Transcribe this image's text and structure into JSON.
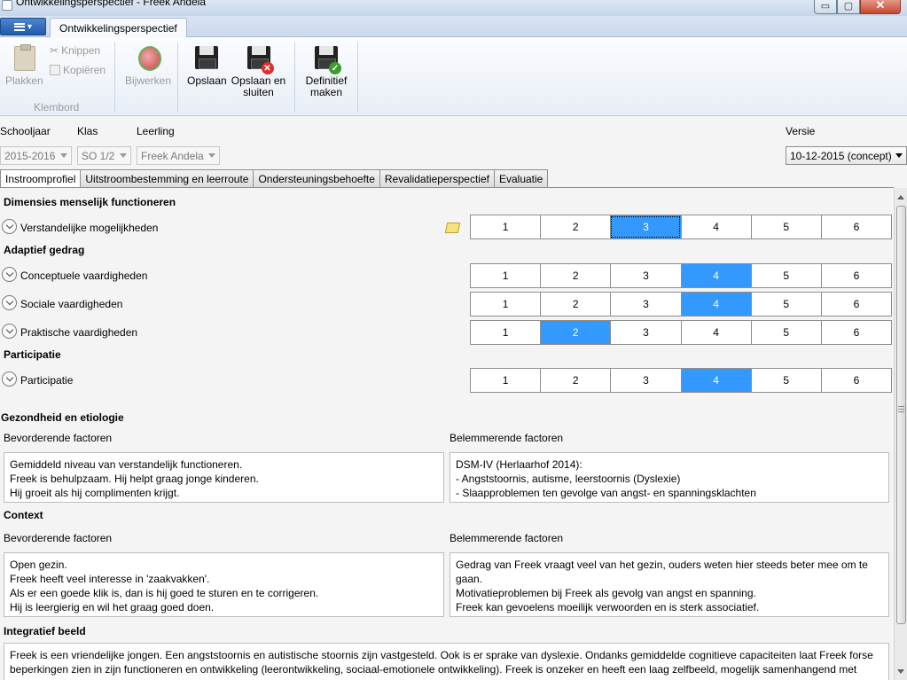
{
  "window": {
    "title": "Ontwikkelingsperspectief - Freek Andela",
    "minimize": "▭",
    "maximize": "▢",
    "close": "✕"
  },
  "ribbon": {
    "tab": "Ontwikkelingsperspectief",
    "paste": "Plakken",
    "cut": "Knippen",
    "copy": "Kopiëren",
    "clipboard_group": "Klembord",
    "update": "Bijwerken",
    "save": "Opslaan",
    "save_close": "Opslaan en sluiten",
    "finalize": "Definitief maken"
  },
  "selectors": {
    "schooljaar_label": "Schooljaar",
    "schooljaar_value": "2015-2016",
    "klas_label": "Klas",
    "klas_value": "SO 1/2",
    "leerling_label": "Leerling",
    "leerling_value": "Freek Andela",
    "versie_label": "Versie",
    "versie_value": "10-12-2015 (concept)"
  },
  "tabs": [
    "Instroomprofiel",
    "Uitstroombestemming en leerroute",
    "Ondersteuningsbehoefte",
    "Revalidatieperspectief",
    "Evaluatie"
  ],
  "content": {
    "dimensies_header": "Dimensies menselijk functioneren",
    "adaptief_header": "Adaptief gedrag",
    "participatie_header": "Participatie",
    "rows": [
      {
        "label": "Verstandelijke mogelijkheden",
        "selected": 3
      },
      {
        "label": "Conceptuele vaardigheden",
        "selected": 4
      },
      {
        "label": "Sociale vaardigheden",
        "selected": 4
      },
      {
        "label": "Praktische vaardigheden",
        "selected": 2
      },
      {
        "label": "Participatie",
        "selected": 4
      }
    ],
    "scale": [
      "1",
      "2",
      "3",
      "4",
      "5",
      "6"
    ],
    "gezondheid_header": "Gezondheid en etiologie",
    "context_header": "Context",
    "bevorderend_label": "Bevorderende factoren",
    "belemmerend_label": "Belemmerende factoren",
    "gezondheid_bevorderend": "Gemiddeld niveau van verstandelijk functioneren.\nFreek is behulpzaam. Hij helpt graag jonge kinderen.\nHij groeit als hij complimenten krijgt.",
    "gezondheid_belemmerend": "DSM-IV (Herlaarhof 2014):\n- Angststoornis, autisme, leerstoornis (Dyslexie)\n- Slaapproblemen ten gevolge van angst- en spanningsklachten",
    "context_bevorderend": "Open gezin.\nFreek heeft veel interesse in 'zaakvakken'.\nAls er een goede klik is, dan is hij goed te sturen en te corrigeren.\nHij is leergierig en wil het graag goed doen.",
    "context_belemmerend": "Gedrag van Freek vraagt veel van het gezin, ouders weten hier steeds beter mee om te gaan.\nMotivatieproblemen bij Freek als gevolg van angst en spanning.\nFreek kan gevoelens moeilijk verwoorden en is sterk associatief.",
    "integratief_header": "Integratief beeld",
    "integratief_text": "Freek is een vriendelijke jongen. Een angststoornis en autistische stoornis zijn vastgesteld. Ook is er sprake van dyslexie. Ondanks gemiddelde cognitieve capaciteiten laat Freek forse beperkingen zien in zijn functioneren en ontwikkeling (leerontwikkeling, sociaal-emotionele ontwikkeling). Freek is onzeker en heeft een laag zelfbeeld, mogelijk samenhangend met"
  }
}
